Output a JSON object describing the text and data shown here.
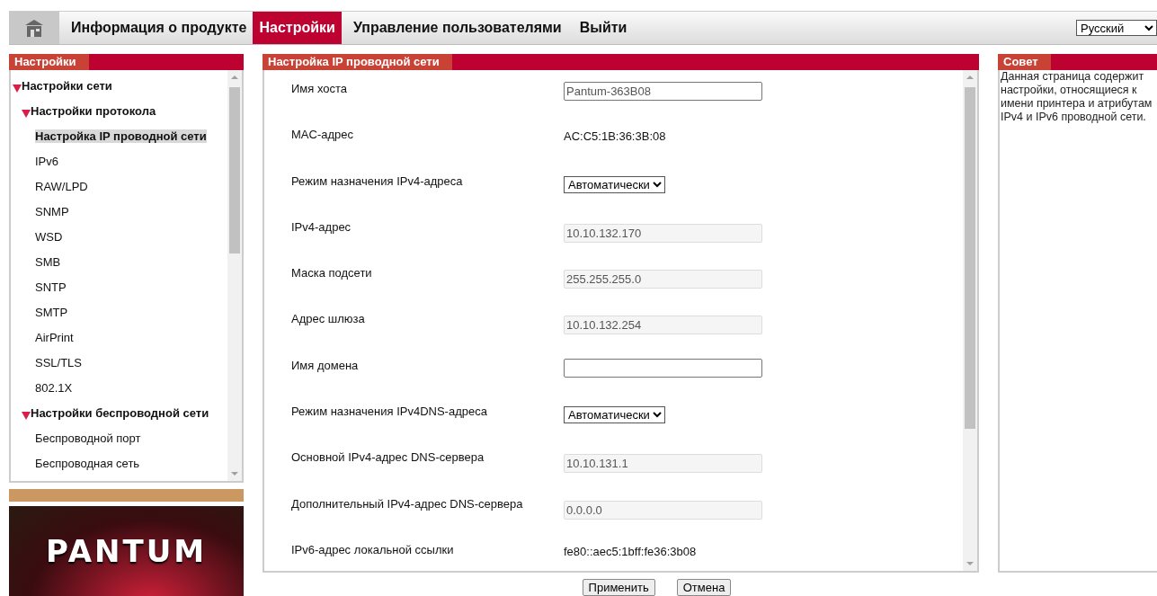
{
  "nav": {
    "tabs": [
      {
        "label": "Информация о продукте",
        "selected": false
      },
      {
        "label": "Настройки",
        "selected": true
      },
      {
        "label": "Управление пользователями",
        "selected": false
      },
      {
        "label": "Выйти",
        "selected": false
      }
    ],
    "language": "Русский"
  },
  "sidebar": {
    "title": "Настройки",
    "tree": [
      {
        "label": "Настройки сети",
        "expanded": true,
        "selected": false,
        "children": [
          {
            "label": "Настройки протокола",
            "expanded": true,
            "selected": false,
            "children": [
              {
                "label": "Настройка IP проводной сети",
                "selected": true
              },
              {
                "label": "IPv6",
                "selected": false
              },
              {
                "label": "RAW/LPD",
                "selected": false
              },
              {
                "label": "SNMP",
                "selected": false
              },
              {
                "label": "WSD",
                "selected": false
              },
              {
                "label": "SMB",
                "selected": false
              },
              {
                "label": "SNTP",
                "selected": false
              },
              {
                "label": "SMTP",
                "selected": false
              },
              {
                "label": "AirPrint",
                "selected": false
              },
              {
                "label": "SSL/TLS",
                "selected": false
              },
              {
                "label": "802.1X",
                "selected": false
              }
            ]
          },
          {
            "label": "Настройки беспроводной сети",
            "expanded": true,
            "selected": false,
            "children": [
              {
                "label": "Беспроводной порт",
                "selected": false
              },
              {
                "label": "Беспроводная сеть",
                "selected": false
              }
            ]
          }
        ]
      }
    ],
    "logo": "PANTUM"
  },
  "main": {
    "title": "Настройка IP проводной сети",
    "fields": [
      {
        "label": "Имя хоста",
        "kind": "input",
        "value": "Pantum-363B08"
      },
      {
        "label": "MAC-адрес",
        "kind": "static",
        "value": "AC:C5:1B:36:3B:08"
      },
      {
        "label": "Режим назначения IPv4-адреса",
        "kind": "select",
        "value": "Автоматически"
      },
      {
        "label": "IPv4-адрес",
        "kind": "readonly",
        "value": "10.10.132.170"
      },
      {
        "label": "Маска подсети",
        "kind": "readonly",
        "value": "255.255.255.0"
      },
      {
        "label": "Адрес шлюза",
        "kind": "readonly",
        "value": "10.10.132.254"
      },
      {
        "label": "Имя домена",
        "kind": "input"
      },
      {
        "label": "Режим назначения IPv4DNS-адреса",
        "kind": "select",
        "value": "Автоматически"
      },
      {
        "label": "Основной IPv4-адрес DNS-сервера",
        "kind": "readonly",
        "value": "10.10.131.1"
      },
      {
        "label": "Дополнительный IPv4-адрес DNS-сервера",
        "kind": "readonly",
        "value": "0.0.0.0"
      },
      {
        "label": "IPv6-адрес локальной ссылки",
        "kind": "static",
        "value": "fe80::aec5:1bff:fe36:3b08"
      }
    ],
    "buttons": [
      "Применить",
      "Отмена"
    ]
  },
  "tip": {
    "title": "Совет",
    "text": "Данная страница содержит настройки, относящиеся к имени принтера и атрибутам IPv4 и IPv6 проводной сети."
  }
}
